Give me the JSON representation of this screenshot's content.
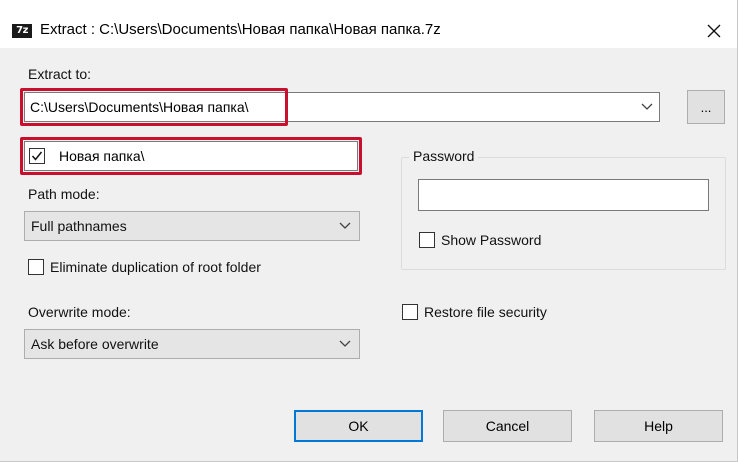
{
  "window": {
    "app_icon": "7z",
    "title": "Extract : C:\\Users\\Documents\\Новая папка\\Новая папка.7z",
    "close_glyph": "✕"
  },
  "extract_to": {
    "label": "Extract to:",
    "value": "C:\\Users\\Documents\\Новая папка\\",
    "browse_label": "..."
  },
  "subfolder": {
    "checked": true,
    "value": "Новая папка\\"
  },
  "path_mode": {
    "label": "Path mode:",
    "selected": "Full pathnames"
  },
  "eliminate_duplication": {
    "label": "Eliminate duplication of root folder",
    "checked": false
  },
  "overwrite_mode": {
    "label": "Overwrite mode:",
    "selected": "Ask before overwrite"
  },
  "password": {
    "group_label": "Password",
    "value": "",
    "show_label": "Show Password",
    "show_checked": false
  },
  "restore_security": {
    "label": "Restore file security",
    "checked": false
  },
  "buttons": {
    "ok": "OK",
    "cancel": "Cancel",
    "help": "Help"
  },
  "colors": {
    "highlight": "#c8102e",
    "default_button_border": "#0078d7",
    "dialog_background": "#f0f0f0"
  }
}
